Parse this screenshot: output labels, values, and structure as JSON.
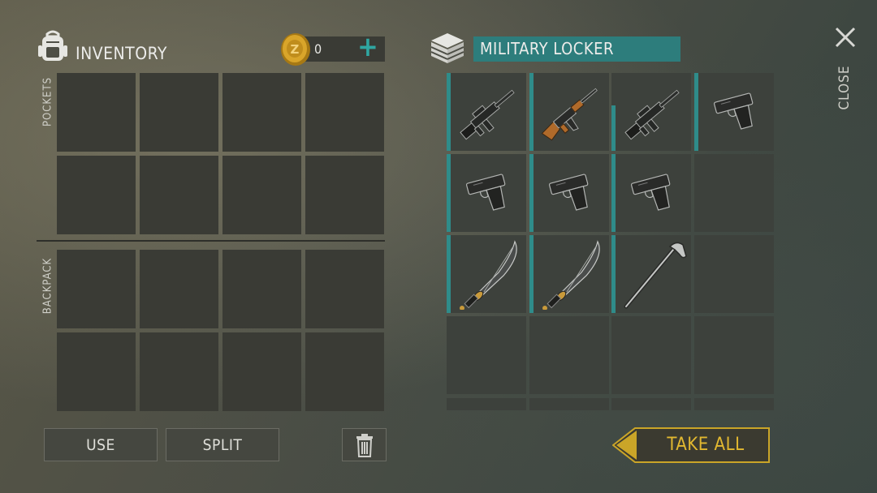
{
  "inventory": {
    "title": "INVENTORY",
    "coins": "0",
    "add_label": "+",
    "pockets_label": "POCKETS",
    "backpack_label": "BACKPACK"
  },
  "container": {
    "title": "MILITARY LOCKER",
    "items": [
      {
        "name": "rifle",
        "icon": "assault-rifle-icon",
        "durability": "full"
      },
      {
        "name": "ak",
        "icon": "ak-rifle-icon",
        "durability": "full"
      },
      {
        "name": "rifle",
        "icon": "assault-rifle-icon",
        "durability": "partial"
      },
      {
        "name": "pistol",
        "icon": "pistol-icon",
        "durability": "full"
      },
      {
        "name": "pistol",
        "icon": "pistol-icon",
        "durability": "full"
      },
      {
        "name": "pistol",
        "icon": "pistol-icon",
        "durability": "full"
      },
      {
        "name": "pistol",
        "icon": "pistol-icon",
        "durability": "full"
      },
      {
        "name": "empty"
      },
      {
        "name": "katana",
        "icon": "katana-icon",
        "durability": "full"
      },
      {
        "name": "katana",
        "icon": "katana-icon",
        "durability": "full"
      },
      {
        "name": "golf",
        "icon": "golf-club-icon",
        "durability": "full"
      },
      {
        "name": "empty"
      }
    ]
  },
  "buttons": {
    "use": "USE",
    "split": "SPLIT",
    "take_all": "TAKE ALL",
    "close": "CLOSE"
  },
  "colors": {
    "accent_teal": "#2f8c8a",
    "take_all_gold": "#caa528",
    "panel": "#3a3b35"
  }
}
